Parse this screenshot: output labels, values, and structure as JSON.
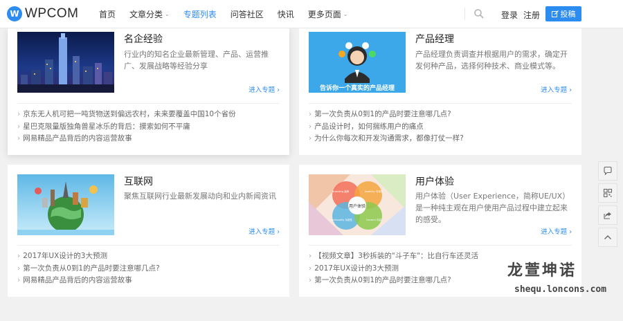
{
  "brand": {
    "logo_text": "WPCOM",
    "mark": "W",
    "accent": "#2d8cf0"
  },
  "nav": [
    {
      "label": "首页",
      "caret": false
    },
    {
      "label": "文章分类",
      "caret": true
    },
    {
      "label": "专题列表",
      "caret": false,
      "active": true
    },
    {
      "label": "问答社区",
      "caret": false
    },
    {
      "label": "快讯",
      "caret": false
    },
    {
      "label": "更多页面",
      "caret": true
    }
  ],
  "header": {
    "login": "登录",
    "register": "注册",
    "post_button": "投稿",
    "caret_glyph": "⌄"
  },
  "cards": [
    {
      "title": "名企经验",
      "desc": "行业内的知名企业最新管理、产品、运营推广、发展战略等经验分享",
      "more": "进入专题 ›",
      "items": [
        "京东无人机可把一吨货物送到偏远农村，未来要覆盖中国10个省份",
        "星巴克限量版独角兽星冰乐的背后：摸索如何不平庸",
        "网易精品产品背后的内容运营故事"
      ]
    },
    {
      "title": "产品经理",
      "desc": "产品经理负责调查并根据用户的需求，确定开发何种产品，选择何种技术、商业模式等。",
      "more": "进入专题 ›",
      "thumb_caption": "告诉你一个真实的产品经理",
      "items": [
        "第一次负责从0到1的产品时要注意哪几点?",
        "产品设计时，如何揣练用户的痛点",
        "为什么你每次和开发沟通需求，都像打仗一样?"
      ]
    },
    {
      "title": "互联网",
      "desc": "聚焦互联网行业最新发展动向和业内新闻资讯",
      "more": "进入专题 ›",
      "items": [
        "2017年UX设计的3大预测",
        "第一次负责从0到1的产品时要注意哪几点?",
        "网易精品产品背后的内容运营故事"
      ]
    },
    {
      "title": "用户体验",
      "desc": "用户体验（User Experience，简称UE/UX）是一种纯主观在用户使用产品过程中建立起来的感受。",
      "more": "进入专题 ›",
      "thumb_center": "用户体验",
      "thumb_labels": [
        "Branding 品牌",
        "Usability 可用性",
        "Functionality 功能性",
        "Content 内容"
      ],
      "items": [
        "【视频文章】3秒拆装的\"斗子车\"：比自行车还灵活",
        "2017年UX设计的3大预测",
        "第一次负责从0到1的产品时要注意哪几点?"
      ]
    }
  ],
  "side_tools": [
    {
      "icon": "comment-icon"
    },
    {
      "icon": "qrcode-icon"
    },
    {
      "icon": "share-icon"
    },
    {
      "icon": "back-to-top-icon"
    }
  ],
  "watermark": {
    "title": "龙萱坤诺",
    "url": "shequ.loncons.com"
  }
}
